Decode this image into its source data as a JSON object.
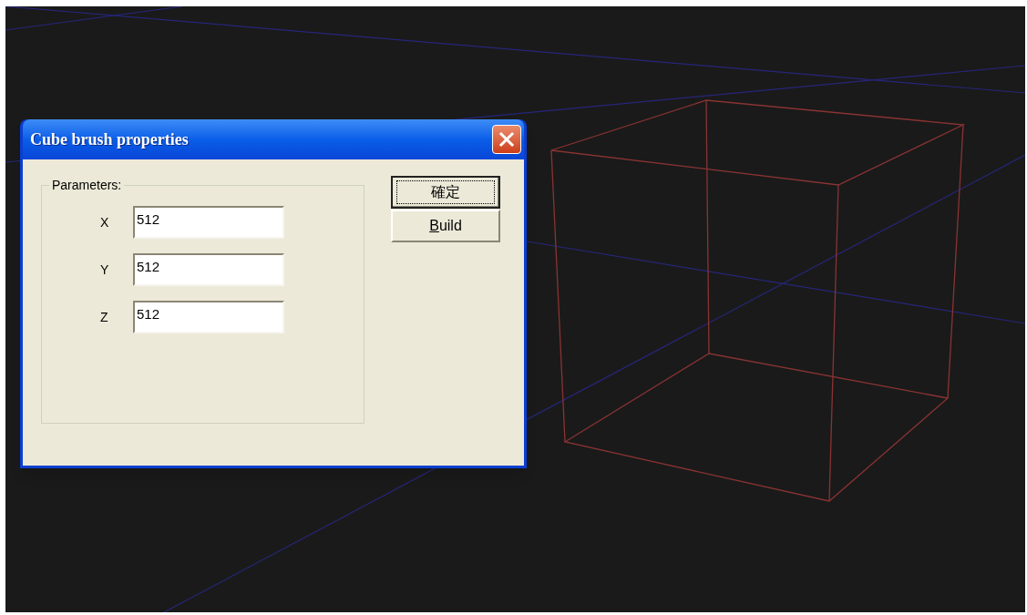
{
  "dialog": {
    "title": "Cube brush properties",
    "group": {
      "label": "Parameters:",
      "fields": [
        {
          "label": "X",
          "value": "512"
        },
        {
          "label": "Y",
          "value": "512"
        },
        {
          "label": "Z",
          "value": "512"
        }
      ]
    },
    "buttons": [
      {
        "label": "確定",
        "default": true,
        "focused": true,
        "access_key_underlined": false
      },
      {
        "label": "Build",
        "default": false,
        "focused": false,
        "access_key_underlined": true
      }
    ]
  }
}
